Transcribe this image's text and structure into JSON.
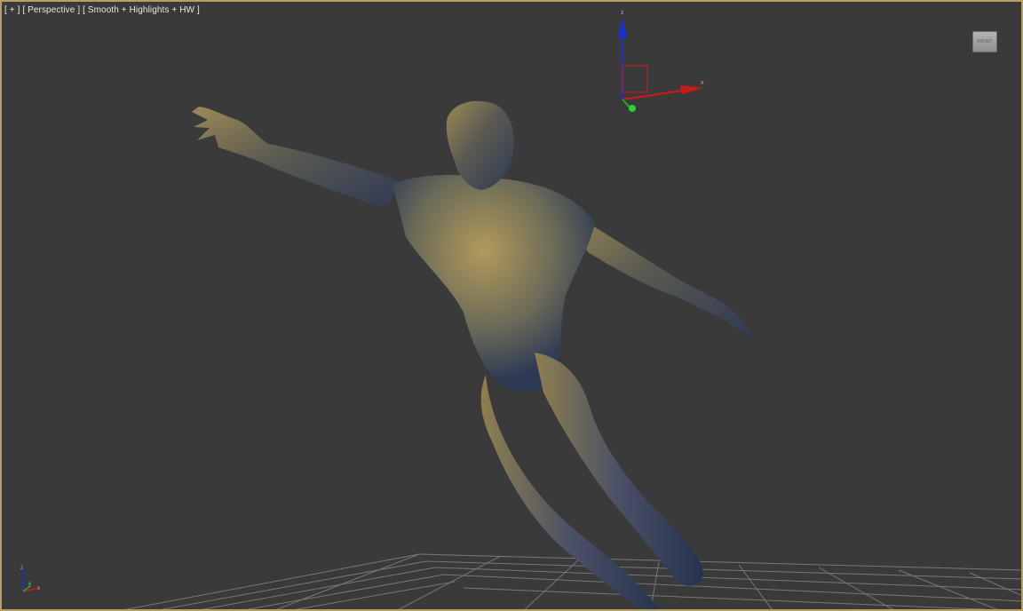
{
  "viewport": {
    "menu_plus": "[ + ]",
    "point_of_view": "[ Perspective ]",
    "shading_mode": "[ Smooth + Highlights + HW ]"
  },
  "viewcube": {
    "face_label": "FRONT"
  },
  "gizmo": {
    "x_label": "x",
    "y_label": "y",
    "z_label": "z"
  },
  "colors": {
    "viewport_bg": "#3a3a3a",
    "active_border": "#b7a064",
    "axis_x": "#d01818",
    "axis_y": "#1fae1f",
    "axis_z": "#1a2fd6",
    "grid": "#8c8c8c"
  }
}
